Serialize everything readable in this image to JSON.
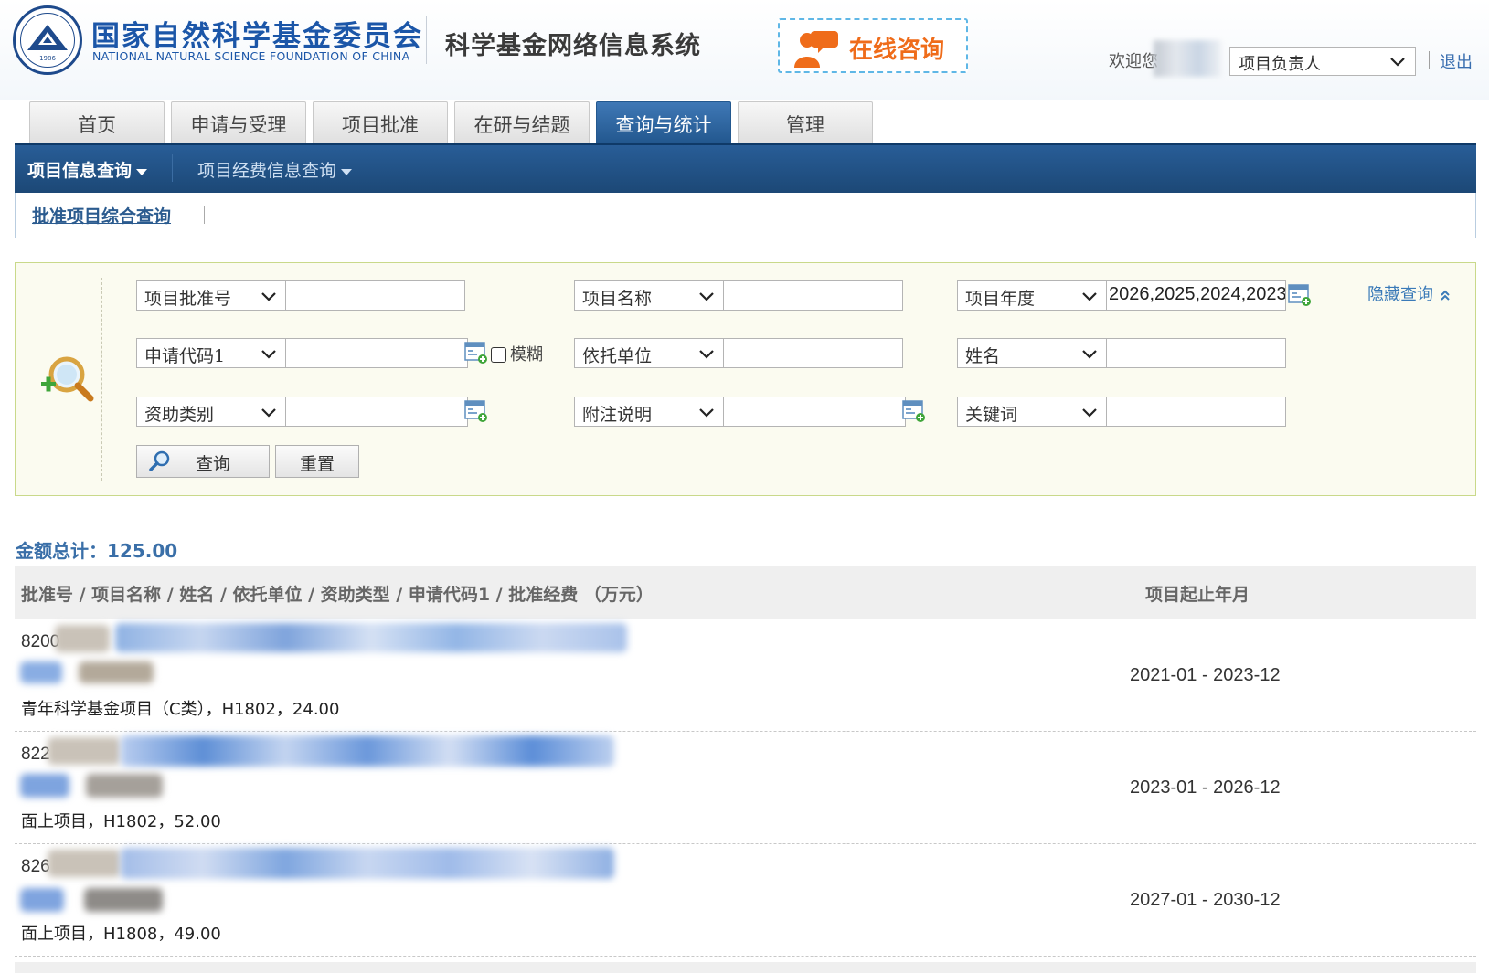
{
  "header": {
    "org_name_cn": "国家自然科学基金委员会",
    "org_name_en": "NATIONAL NATURAL SCIENCE FOUNDATION OF CHINA",
    "seal_year": "1986",
    "system_title": "科学基金网络信息系统",
    "consult_label": "在线咨询",
    "welcome": "欢迎您",
    "role": "项目负责人",
    "logout": "退出"
  },
  "tabs": [
    {
      "label": "首页"
    },
    {
      "label": "申请与受理"
    },
    {
      "label": "项目批准"
    },
    {
      "label": "在研与结题"
    },
    {
      "label": "查询与统计",
      "active": true
    },
    {
      "label": "管理"
    }
  ],
  "nav": {
    "items": [
      "项目信息查询",
      "项目经费信息查询"
    ],
    "sub_link": "批准项目综合查询"
  },
  "query": {
    "hide_label": "隐藏查询",
    "fields": {
      "approval_no": {
        "label": "项目批准号",
        "value": ""
      },
      "project_name": {
        "label": "项目名称",
        "value": ""
      },
      "project_year": {
        "label": "项目年度",
        "value": "2026,2025,2024,2023,"
      },
      "apply_code": {
        "label": "申请代码1",
        "value": ""
      },
      "fuzzy": {
        "label": "模糊",
        "checked": false
      },
      "institution": {
        "label": "依托单位",
        "value": ""
      },
      "name": {
        "label": "姓名",
        "value": ""
      },
      "funding_type": {
        "label": "资助类别",
        "value": ""
      },
      "note": {
        "label": "附注说明",
        "value": ""
      },
      "keyword": {
        "label": "关键词",
        "value": ""
      }
    },
    "search_button": "查询",
    "reset_button": "重置"
  },
  "results": {
    "total": "金额总计：125.00",
    "header_left": "批准号 / 项目名称 / 姓名 / 依托单位 / 资助类型 / 申请代码1 / 批准经费 （万元）",
    "header_right": "项目起止年月",
    "rows": [
      {
        "code_prefix": "8200",
        "meta": "青年科学基金项目（C类），H1802，24.00",
        "period": "2021-01 - 2023-12"
      },
      {
        "code_prefix": "822",
        "meta": "面上项目，H1802，52.00",
        "period": "2023-01 - 2026-12"
      },
      {
        "code_prefix": "826",
        "meta": "面上项目，H1808，49.00",
        "period": "2027-01 - 2030-12"
      }
    ]
  },
  "colors": {
    "brand_blue": "#1b56a8",
    "nav_blue": "#23588f",
    "consult_orange": "#ef6c1a",
    "panel_bg": "#fbfbf0",
    "total_blue": "#3a6fa8"
  },
  "icons": [
    "nsfc-seal-icon",
    "consult-person-icon",
    "chevron-down-icon",
    "search-magnifier-icon",
    "calendar-picker-icon",
    "double-chevron-up-icon"
  ]
}
